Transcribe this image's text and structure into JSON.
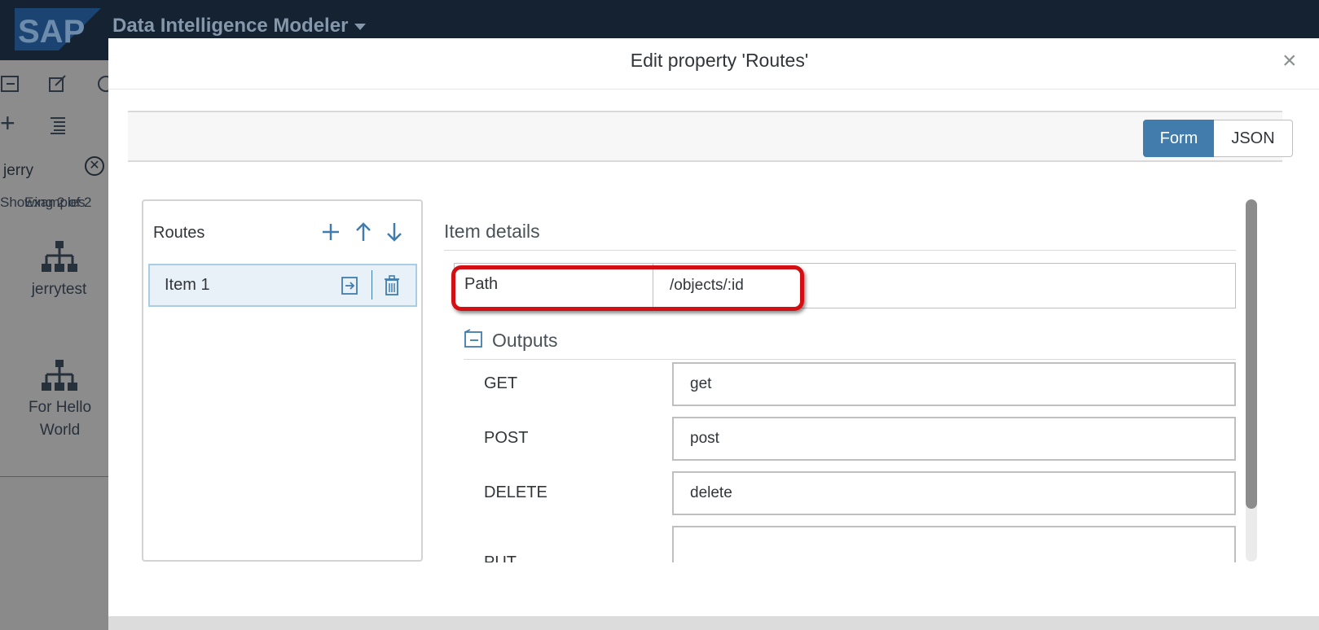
{
  "app": {
    "logo_text": "SAP",
    "title": "Data Intelligence Modeler"
  },
  "background": {
    "filter_text": "jerry",
    "section_label_1": "Showing 2 of 2",
    "section_label_2": "Examples",
    "tiles": [
      {
        "label": "jerrytest"
      },
      {
        "label": "For Hello World"
      }
    ]
  },
  "dialog": {
    "title": "Edit property 'Routes'",
    "close_symbol": "×",
    "view_toggle": {
      "form": "Form",
      "json": "JSON",
      "selected": "Form"
    },
    "list": {
      "title": "Routes",
      "items": [
        {
          "label": "Item 1"
        }
      ]
    },
    "details": {
      "title": "Item details",
      "path_label": "Path",
      "path_value": "/objects/:id",
      "outputs_title": "Outputs",
      "outputs": [
        {
          "label": "GET",
          "value": "get"
        },
        {
          "label": "POST",
          "value": "post"
        },
        {
          "label": "DELETE",
          "value": "delete"
        },
        {
          "label": "PUT",
          "value": ""
        }
      ]
    }
  },
  "colors": {
    "shell": "#142232",
    "accent": "#427cac",
    "highlight": "#d30f14"
  }
}
